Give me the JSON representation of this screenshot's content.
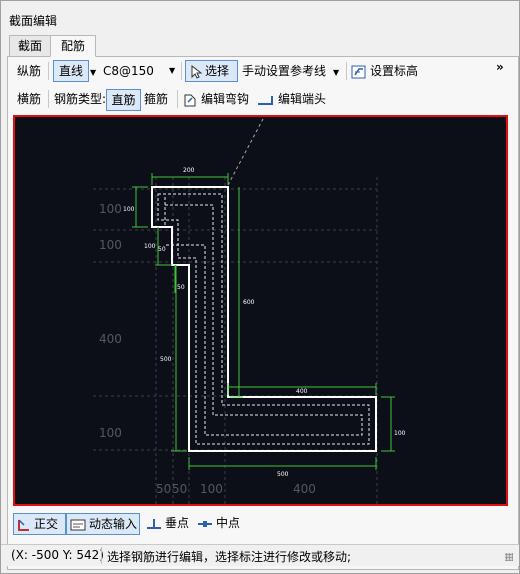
{
  "window": {
    "title": "截面编辑"
  },
  "tabs": [
    {
      "label": "截面"
    },
    {
      "label": "配筋"
    }
  ],
  "toolbar1": {
    "rebar_type": "纵筋",
    "line_mode": "直线",
    "rebar_spec": "C8@150",
    "select": "选择",
    "manual_ref": "手动设置参考线",
    "set_elevation": "设置标高",
    "overflow": "»"
  },
  "toolbar2": {
    "transverse": "横筋",
    "bar_type_label": "钢筋类型:",
    "straight": "直筋",
    "stirrup": "箍筋",
    "edit_hook": "编辑弯钩",
    "edit_end": "编辑端头"
  },
  "drawing": {
    "dim_200": "200",
    "dim_100a": "100",
    "dim_100b": "100",
    "dim_50a": "50",
    "dim_50b": "50",
    "dim_600": "600",
    "dim_500": "500",
    "dim_400": "400",
    "dim_100r": "100",
    "dim_500b": "500",
    "grid_100_1": "100",
    "grid_100_2": "100",
    "grid_400_left": "400",
    "grid_100_3": "100",
    "grid_50_1": "50",
    "grid_50_2": "50",
    "grid_100_bottom": "100",
    "grid_400_bottom": "400"
  },
  "bottom_bar": {
    "ortho": "正交",
    "dynamic": "动态输入",
    "perpendicular": "垂点",
    "midpoint": "中点"
  },
  "status": {
    "coords": "(X: -500 Y: 542)",
    "message": "选择钢筋进行编辑，选择标注进行修改或移动;"
  }
}
